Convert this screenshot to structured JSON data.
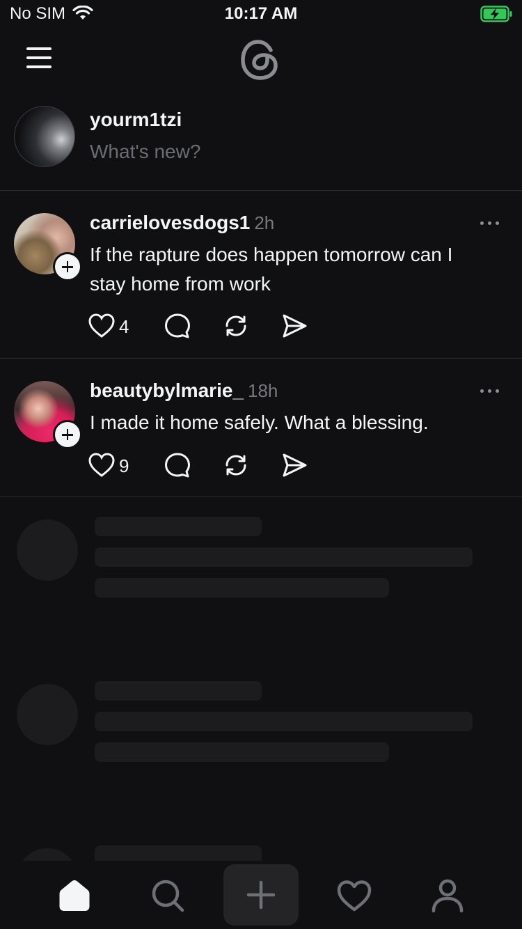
{
  "status_bar": {
    "carrier": "No SIM",
    "time": "10:17 AM"
  },
  "colors": {
    "background": "#101012",
    "text": "#f3f5f7",
    "muted": "#77797e",
    "battery": "#35c759"
  },
  "composer": {
    "username": "yourm1tzi",
    "placeholder": "What's new?"
  },
  "posts": [
    {
      "username": "carrielovesdogs1",
      "time": "2h",
      "text_line1": "If the rapture does happen tomorrow can I",
      "text_line2": "stay home from work",
      "likes": "4"
    },
    {
      "username": "beautybylmarie_",
      "time": "18h",
      "text_line1": "I made it home safely. What a blessing.",
      "likes": "9"
    }
  ],
  "icons": {
    "menu": "hamburger-icon",
    "logo": "threads-logo",
    "like": "heart-icon",
    "comment": "comment-bubble-icon",
    "repost": "repost-icon",
    "share": "send-icon",
    "more": "more-horizontal-icon",
    "nav": [
      "home-icon",
      "search-icon",
      "plus-icon",
      "heart-icon",
      "profile-icon"
    ]
  }
}
